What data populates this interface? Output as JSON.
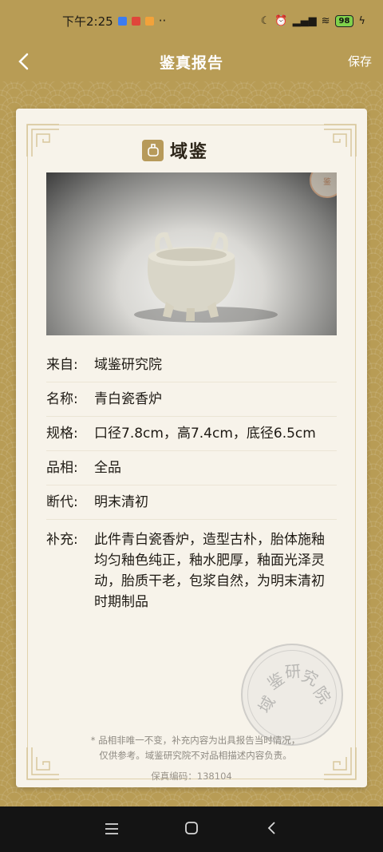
{
  "status": {
    "time": "下午2:25",
    "battery": "98"
  },
  "nav": {
    "title": "鉴真报告",
    "save_label": "保存"
  },
  "brand": {
    "name": "域鉴"
  },
  "report": {
    "rows": [
      {
        "label": "来自:",
        "value": "域鉴研究院"
      },
      {
        "label": "名称:",
        "value": "青白瓷香炉"
      },
      {
        "label": "规格:",
        "value": "口径7.8cm，高7.4cm，底径6.5cm"
      },
      {
        "label": "品相:",
        "value": "全品"
      },
      {
        "label": "断代:",
        "value": "明末清初"
      },
      {
        "label": "补充:",
        "value": "此件青白瓷香炉，造型古朴，胎体施釉均匀釉色纯正，釉水肥厚，釉面光泽灵动，胎质干老，包浆自然，为明末清初时期制品"
      }
    ],
    "disclaimer_line1": "* 品相非唯一不变，补充内容为出具报告当时情况，",
    "disclaimer_line2": "仅供参考。域鉴研究院不对品相描述内容负责。",
    "serial": "保真编码：138104"
  },
  "colors": {
    "gold": "#b89c55",
    "card": "#f7f3ea",
    "nav_dark": "#141414"
  },
  "icons": {
    "back": "chevron-left-icon",
    "menu": "menu-icon",
    "home": "home-icon",
    "sys_back": "back-icon"
  }
}
